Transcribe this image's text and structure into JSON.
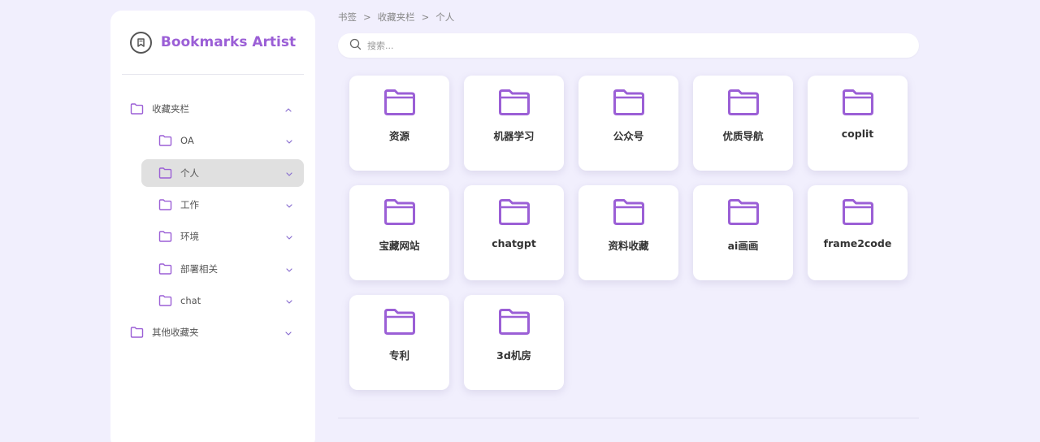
{
  "brand": {
    "title": "Bookmarks Artist",
    "logo_icon": "bookmark-icon"
  },
  "colors": {
    "accent": "#9b5fd6",
    "background": "#f1effd",
    "card": "#ffffff",
    "active": "#e0e0e0"
  },
  "sidebar": {
    "items": [
      {
        "label": "收藏夹栏",
        "level": 0,
        "chevron": "up"
      },
      {
        "label": "OA",
        "level": 1,
        "chevron": "down"
      },
      {
        "label": "个人",
        "level": 1,
        "chevron": "down",
        "active": true
      },
      {
        "label": "工作",
        "level": 1,
        "chevron": "down"
      },
      {
        "label": "环境",
        "level": 1,
        "chevron": "down"
      },
      {
        "label": "部署相关",
        "level": 1,
        "chevron": "down"
      },
      {
        "label": "chat",
        "level": 1,
        "chevron": "down"
      },
      {
        "label": "其他收藏夹",
        "level": 0,
        "chevron": "down"
      }
    ]
  },
  "breadcrumb": {
    "items": [
      "书签",
      "收藏夹栏",
      "个人"
    ],
    "separator": ">"
  },
  "search": {
    "placeholder": "搜索..."
  },
  "folders": [
    "资源",
    "机器学习",
    "公众号",
    "优质导航",
    "coplit",
    "宝藏网站",
    "chatgpt",
    "资料收藏",
    "ai画画",
    "frame2code",
    "专利",
    "3d机房"
  ]
}
